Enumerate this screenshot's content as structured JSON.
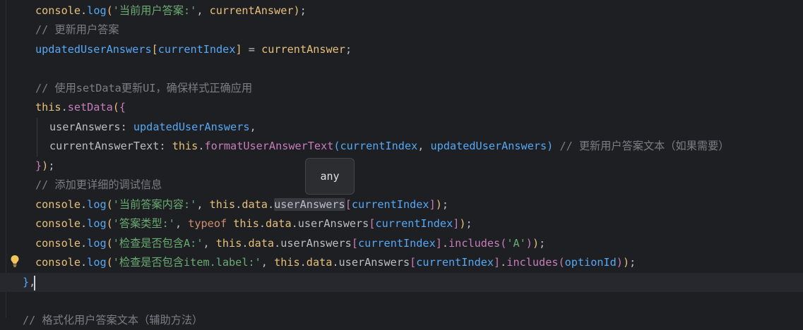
{
  "editor": {
    "lines": [
      {
        "id": "l1",
        "tokens": [
          {
            "t": "console",
            "c": "c-console"
          },
          {
            "t": ".",
            "c": "c-default"
          },
          {
            "t": "log",
            "c": "c-fn"
          },
          {
            "t": "(",
            "c": "c-br1"
          },
          {
            "t": "'当前用户答案:'",
            "c": "c-str"
          },
          {
            "t": ", ",
            "c": "c-default"
          },
          {
            "t": "currentAnswer",
            "c": "c-console"
          },
          {
            "t": ")",
            "c": "c-br1"
          },
          {
            "t": ";",
            "c": "c-default"
          }
        ]
      },
      {
        "id": "l2",
        "tokens": [
          {
            "t": "// 更新用户答案",
            "c": "c-comment"
          }
        ]
      },
      {
        "id": "l3",
        "tokens": [
          {
            "t": "updatedUserAnswers",
            "c": "c-fn"
          },
          {
            "t": "[",
            "c": "c-br1"
          },
          {
            "t": "currentIndex",
            "c": "c-fn"
          },
          {
            "t": "]",
            "c": "c-br1"
          },
          {
            "t": " = ",
            "c": "c-default"
          },
          {
            "t": "currentAnswer",
            "c": "c-console"
          },
          {
            "t": ";",
            "c": "c-default"
          }
        ]
      },
      {
        "id": "l4",
        "tokens": []
      },
      {
        "id": "l5",
        "tokens": [
          {
            "t": "// 使用setData更新UI，确保样式正确应用",
            "c": "c-comment"
          }
        ]
      },
      {
        "id": "l6",
        "tokens": [
          {
            "t": "this",
            "c": "c-console"
          },
          {
            "t": ".",
            "c": "c-default"
          },
          {
            "t": "setData",
            "c": "c-var"
          },
          {
            "t": "(",
            "c": "c-br1"
          },
          {
            "t": "{",
            "c": "c-br2"
          }
        ]
      },
      {
        "id": "l7",
        "tokens": [
          {
            "t": "userAnswers",
            "c": "c-default"
          },
          {
            "t": ": ",
            "c": "c-default"
          },
          {
            "t": "updatedUserAnswers",
            "c": "c-fn"
          },
          {
            "t": ",",
            "c": "c-default"
          }
        ]
      },
      {
        "id": "l8",
        "tokens": [
          {
            "t": "currentAnswerText",
            "c": "c-default"
          },
          {
            "t": ": ",
            "c": "c-default"
          },
          {
            "t": "this",
            "c": "c-console"
          },
          {
            "t": ".",
            "c": "c-default"
          },
          {
            "t": "formatUserAnswerText",
            "c": "c-var"
          },
          {
            "t": "(",
            "c": "c-br3"
          },
          {
            "t": "currentIndex",
            "c": "c-fn"
          },
          {
            "t": ", ",
            "c": "c-default"
          },
          {
            "t": "updatedUserAnswers",
            "c": "c-fn"
          },
          {
            "t": ")",
            "c": "c-br3"
          },
          {
            "t": " // 更新用户答案文本（如果需要）",
            "c": "c-comment"
          }
        ]
      },
      {
        "id": "l9",
        "tokens": [
          {
            "t": "}",
            "c": "c-br2"
          },
          {
            "t": ")",
            "c": "c-br1"
          },
          {
            "t": ";",
            "c": "c-default"
          }
        ]
      },
      {
        "id": "l10",
        "tokens": [
          {
            "t": "// 添加更详细的调试信息",
            "c": "c-comment"
          }
        ]
      },
      {
        "id": "l11",
        "tokens": [
          {
            "t": "console",
            "c": "c-console"
          },
          {
            "t": ".",
            "c": "c-default"
          },
          {
            "t": "log",
            "c": "c-fn"
          },
          {
            "t": "(",
            "c": "c-br1"
          },
          {
            "t": "'当前答案内容:'",
            "c": "c-str"
          },
          {
            "t": ", ",
            "c": "c-default"
          },
          {
            "t": "this",
            "c": "c-console"
          },
          {
            "t": ".",
            "c": "c-default"
          },
          {
            "t": "data",
            "c": "c-console"
          },
          {
            "t": ".",
            "c": "c-default"
          },
          {
            "t": "userAnswers",
            "c": "c-default hl-word"
          },
          {
            "t": "[",
            "c": "c-br2"
          },
          {
            "t": "currentIndex",
            "c": "c-fn"
          },
          {
            "t": "]",
            "c": "c-br2"
          },
          {
            "t": ")",
            "c": "c-br1"
          },
          {
            "t": ";",
            "c": "c-default"
          }
        ]
      },
      {
        "id": "l12",
        "tokens": [
          {
            "t": "console",
            "c": "c-console"
          },
          {
            "t": ".",
            "c": "c-default"
          },
          {
            "t": "log",
            "c": "c-fn"
          },
          {
            "t": "(",
            "c": "c-br1"
          },
          {
            "t": "'答案类型:'",
            "c": "c-str"
          },
          {
            "t": ", ",
            "c": "c-default"
          },
          {
            "t": "typeof",
            "c": "c-kw"
          },
          {
            "t": " ",
            "c": "c-default"
          },
          {
            "t": "this",
            "c": "c-console"
          },
          {
            "t": ".",
            "c": "c-default"
          },
          {
            "t": "data",
            "c": "c-console"
          },
          {
            "t": ".",
            "c": "c-default"
          },
          {
            "t": "userAnswers",
            "c": "c-default"
          },
          {
            "t": "[",
            "c": "c-br2"
          },
          {
            "t": "currentIndex",
            "c": "c-fn"
          },
          {
            "t": "]",
            "c": "c-br2"
          },
          {
            "t": ")",
            "c": "c-br1"
          },
          {
            "t": ";",
            "c": "c-default"
          }
        ]
      },
      {
        "id": "l13",
        "tokens": [
          {
            "t": "console",
            "c": "c-console"
          },
          {
            "t": ".",
            "c": "c-default"
          },
          {
            "t": "log",
            "c": "c-fn"
          },
          {
            "t": "(",
            "c": "c-br1"
          },
          {
            "t": "'检查是否包含A:'",
            "c": "c-str"
          },
          {
            "t": ", ",
            "c": "c-default"
          },
          {
            "t": "this",
            "c": "c-console"
          },
          {
            "t": ".",
            "c": "c-default"
          },
          {
            "t": "data",
            "c": "c-console"
          },
          {
            "t": ".",
            "c": "c-default"
          },
          {
            "t": "userAnswers",
            "c": "c-default"
          },
          {
            "t": "[",
            "c": "c-br2"
          },
          {
            "t": "currentIndex",
            "c": "c-fn"
          },
          {
            "t": "]",
            "c": "c-br2"
          },
          {
            "t": ".",
            "c": "c-default"
          },
          {
            "t": "includes",
            "c": "c-var"
          },
          {
            "t": "(",
            "c": "c-br2"
          },
          {
            "t": "'A'",
            "c": "c-str"
          },
          {
            "t": ")",
            "c": "c-br2"
          },
          {
            "t": ")",
            "c": "c-br1"
          },
          {
            "t": ";",
            "c": "c-default"
          }
        ]
      },
      {
        "id": "l14",
        "tokens": [
          {
            "t": "console",
            "c": "c-console"
          },
          {
            "t": ".",
            "c": "c-default"
          },
          {
            "t": "log",
            "c": "c-fn"
          },
          {
            "t": "(",
            "c": "c-br1"
          },
          {
            "t": "'检查是否包含item.label:'",
            "c": "c-str"
          },
          {
            "t": ", ",
            "c": "c-default"
          },
          {
            "t": "this",
            "c": "c-console"
          },
          {
            "t": ".",
            "c": "c-default"
          },
          {
            "t": "data",
            "c": "c-console"
          },
          {
            "t": ".",
            "c": "c-default"
          },
          {
            "t": "userAnswers",
            "c": "c-default"
          },
          {
            "t": "[",
            "c": "c-br2"
          },
          {
            "t": "currentIndex",
            "c": "c-fn"
          },
          {
            "t": "]",
            "c": "c-br2"
          },
          {
            "t": ".",
            "c": "c-default"
          },
          {
            "t": "includes",
            "c": "c-var"
          },
          {
            "t": "(",
            "c": "c-br2"
          },
          {
            "t": "optionId",
            "c": "c-fn"
          },
          {
            "t": ")",
            "c": "c-br2"
          },
          {
            "t": ")",
            "c": "c-br1"
          },
          {
            "t": ";",
            "c": "c-default"
          }
        ]
      },
      {
        "id": "l15",
        "tokens": [
          {
            "t": "}",
            "c": "c-br3"
          },
          {
            "t": ",",
            "c": "c-default"
          }
        ]
      },
      {
        "id": "l16",
        "tokens": []
      },
      {
        "id": "l17",
        "tokens": [
          {
            "t": "// 格式化用户答案文本（辅助方法）",
            "c": "c-comment"
          }
        ]
      }
    ],
    "tooltip": {
      "text": "any"
    },
    "icons": {
      "intention_bulb": "lightbulb-icon"
    },
    "colors": {
      "background": "#1e1f22",
      "current_line": "#26282e"
    }
  }
}
